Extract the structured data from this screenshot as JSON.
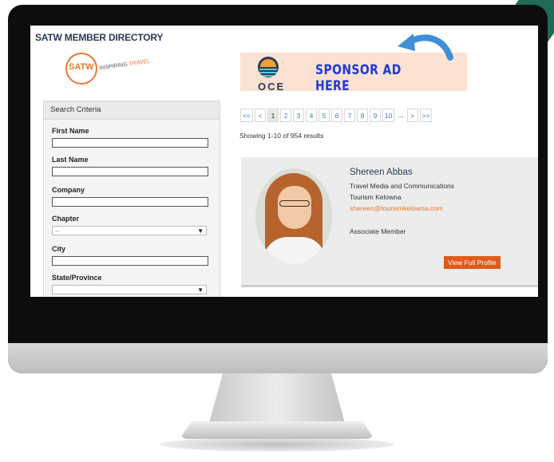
{
  "directory": {
    "title": "SATW MEMBER DIRECTORY",
    "logo_text": "SATW",
    "logo_tagline_1": "INSPIRING",
    "logo_tagline_2": "TRAVEL"
  },
  "sponsor": {
    "text": "SPONSOR AD HERE",
    "logo_partial": "OCE",
    "colors": {
      "background": "#fbe1d2",
      "text": "#1d3bd6"
    }
  },
  "search": {
    "header": "Search Criteria",
    "fields": [
      {
        "label": "First Name",
        "value": ""
      },
      {
        "label": "Last Name",
        "value": ""
      },
      {
        "label": "Company",
        "value": ""
      },
      {
        "label": "Chapter",
        "value": "--"
      },
      {
        "label": "City",
        "value": ""
      },
      {
        "label": "State/Province",
        "value": ""
      }
    ]
  },
  "pagination": {
    "items": [
      "<<",
      "<",
      "1",
      "2",
      "3",
      "4",
      "5",
      "6",
      "7",
      "8",
      "9",
      "10",
      "...",
      ">",
      ">>"
    ],
    "current": "1",
    "results": "Showing 1-10 of 954 results"
  },
  "member": {
    "name": "Shereen Abbas",
    "title": "Travel Media and Communications",
    "company": "Tourism Kelowna",
    "email": "shereen@tourismkelowna.com",
    "type": "Associate Member",
    "button_label": "View Full Profile",
    "colors": {
      "accent": "#e8772e",
      "button": "#e05a1a"
    }
  }
}
